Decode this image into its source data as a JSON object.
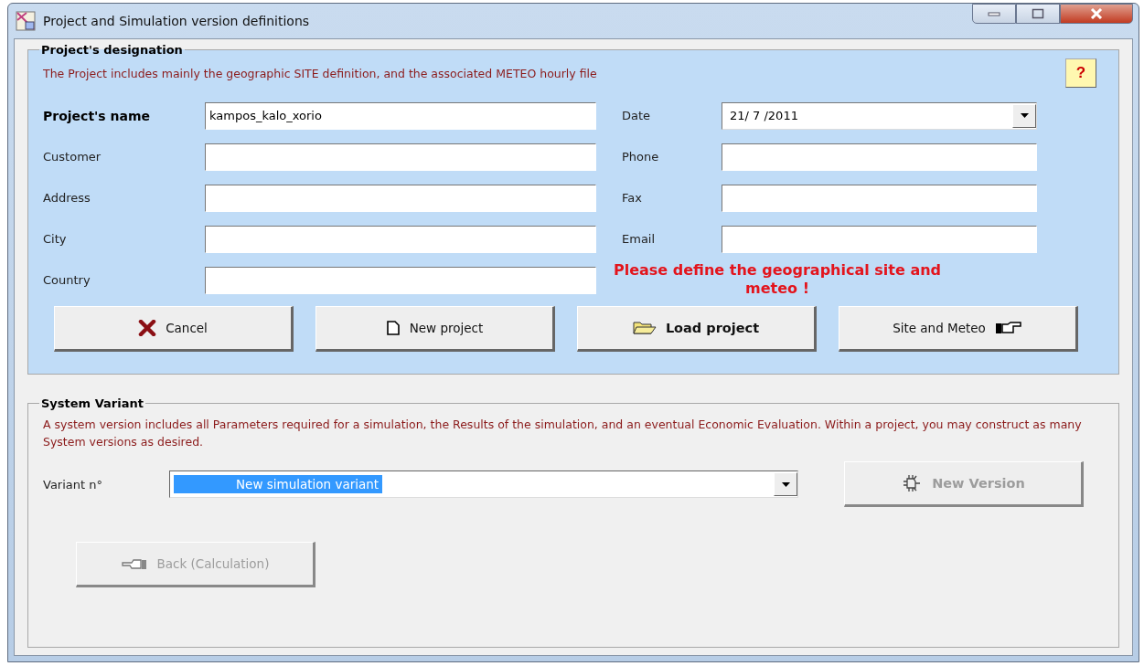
{
  "window": {
    "title": "Project and Simulation version definitions"
  },
  "project": {
    "heading": "Project's designation",
    "note": "The Project includes mainly the geographic SITE definition, and the associated  METEO  hourly file",
    "help": "?",
    "left_fields": [
      {
        "label": "Project's name",
        "value": "kampos_kalo_xorio",
        "emphasis": true
      },
      {
        "label": "Customer",
        "emphasis": false
      },
      {
        "label": "Address",
        "emphasis": false
      },
      {
        "label": "City",
        "emphasis": false
      },
      {
        "label": "Country",
        "emphasis": false
      }
    ],
    "right_fields": [
      {
        "kind": "dropdown",
        "label": "Date",
        "value": "21/ 7 /2011"
      },
      {
        "kind": "text",
        "label": "Phone"
      },
      {
        "kind": "text",
        "label": "Fax"
      },
      {
        "kind": "text",
        "label": "Email"
      }
    ],
    "warning": "Please define the geographical site and meteo !",
    "buttons": [
      {
        "kind": "cancel",
        "label": "Cancel",
        "emphasis": false,
        "disabled": false
      },
      {
        "kind": "new",
        "label": "New project",
        "emphasis": false,
        "disabled": false
      },
      {
        "kind": "load",
        "label": "Load project",
        "emphasis": true,
        "disabled": false
      },
      {
        "kind": "site",
        "label": "Site and Meteo",
        "emphasis": false,
        "disabled": false
      }
    ]
  },
  "system": {
    "heading": "System Variant",
    "note": "A system version includes all Parameters required for a simulation, the Results of the simulation, and an eventual Economic Evaluation.  Within a project, you may construct as many System versions as desired.",
    "variant": {
      "label": "Variant n°",
      "value": "New simulation variant",
      "selected": true
    },
    "new_version": {
      "label": "New Version",
      "emphasis": true,
      "disabled": true
    },
    "back": {
      "label": "Back (Calculation)",
      "emphasis": false,
      "disabled": true
    }
  }
}
